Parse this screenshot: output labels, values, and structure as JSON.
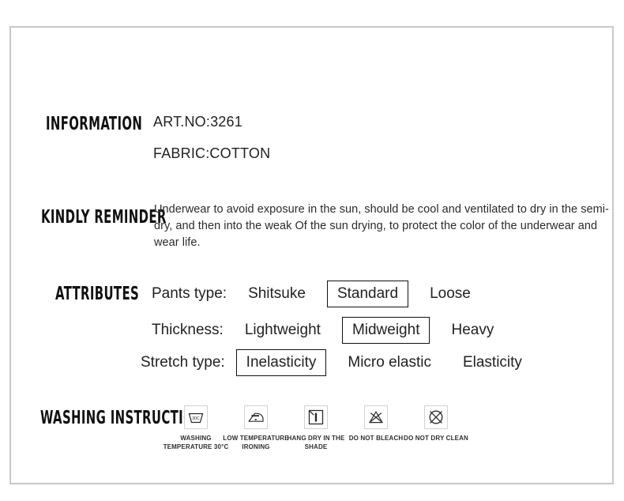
{
  "panel": {
    "border_color": "#c8c8c8",
    "background": "#ffffff"
  },
  "information": {
    "label": "INFORMATION",
    "art_no": "ART.NO:3261",
    "fabric": "FABRIC:COTTON"
  },
  "kindly_reminder": {
    "label": "KINDLY REMINDER",
    "text": "Underwear to avoid exposure in the sun, should be cool and ventilated to dry in the semi-dry, and then into the weak Of the sun drying, to protect the color of the underwear and wear life."
  },
  "attributes": {
    "label": "ATTRIBUTES",
    "rows": [
      {
        "key": "Pants type:",
        "options": [
          {
            "label": "Shitsuke",
            "selected": false
          },
          {
            "label": "Standard",
            "selected": true
          },
          {
            "label": "Loose",
            "selected": false
          }
        ]
      },
      {
        "key": "Thickness:",
        "options": [
          {
            "label": "Lightweight",
            "selected": false
          },
          {
            "label": "Midweight",
            "selected": true
          },
          {
            "label": "Heavy",
            "selected": false
          }
        ]
      },
      {
        "key": "Stretch type:",
        "options": [
          {
            "label": "Inelasticity",
            "selected": true
          },
          {
            "label": "Micro elastic",
            "selected": false
          },
          {
            "label": "Elasticity",
            "selected": false
          }
        ]
      }
    ],
    "selected_border_color": "#111111"
  },
  "washing_instruction": {
    "label": "WASHING INSTRUCTION",
    "symbols": [
      {
        "icon": "wash-tub-30c-icon",
        "caption": "WASHING TEMPERATURE 30°C",
        "temp": "30C"
      },
      {
        "icon": "iron-low-temperature-icon",
        "caption": "LOW TEMPERATURE IRONING"
      },
      {
        "icon": "hang-dry-in-shade-icon",
        "caption": "HANG DRY IN THE SHADE"
      },
      {
        "icon": "do-not-bleach-icon",
        "caption": "DO NOT BLEACH"
      },
      {
        "icon": "do-not-dry-clean-icon",
        "caption": "DO NOT DRY CLEAN"
      }
    ]
  }
}
